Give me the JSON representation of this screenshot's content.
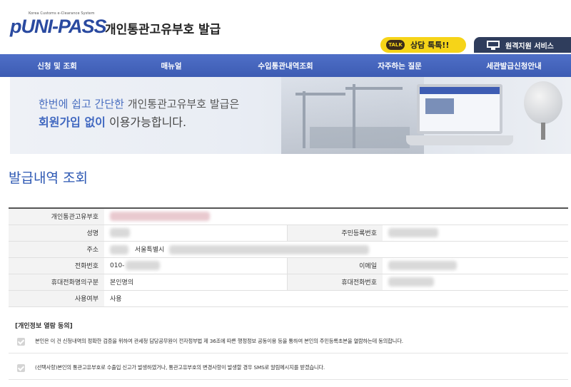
{
  "header": {
    "logo_subtitle": "Korea Customs e-Clearance System",
    "logo_text": "UNI-PASS",
    "logo_prefix": "p",
    "site_title": "개인통관고유부호 발급",
    "talk_icon_text": "TALK",
    "talk_button": "상담 톡톡!!",
    "remote_button": "원격지원 서비스"
  },
  "nav": {
    "items": [
      "신청 및 조회",
      "매뉴얼",
      "수입통관내역조회",
      "자주하는 질문",
      "세관발급신청안내"
    ]
  },
  "banner": {
    "line1_a": "한번에 쉽고 간단한",
    "line1_b": " 개인통관고유부호 발급은",
    "line2_a": "회원가입 없이",
    "line2_b": " 이용가능합니다."
  },
  "page_title": "발급내역 조회",
  "info": {
    "code_label": "개인통관고유부호",
    "name_label": "성명",
    "rrn_label": "주민등록번호",
    "address_label": "주소",
    "address_value": "서울특별시",
    "phone_label": "전화번호",
    "phone_value": "010-",
    "email_label": "이메일",
    "mobile_owner_label": "휴대전화명의구분",
    "mobile_owner_value": "본인명의",
    "mobile_label": "휴대전화번호",
    "usage_label": "사용여부",
    "usage_value": "사용"
  },
  "consent": {
    "title": "[개인정보 열람 동의]",
    "item1": "본인은 이 건 신청내역의 정확한 검증을 위하여 관세청 담당공무원이 전자정부법 제 36조에 따른 행정정보 공동이용 등을 통하여 본인의 주민등록초본을 열람하는데 동의합니다.",
    "item2": "(선택사항)본인의 통관고유부호로 수출입 신고가 발생하였거나, 통관고유부호의 변경사항이 발생할 경우 SMS로 알림메시지를 받겠습니다."
  },
  "colors": {
    "brand_blue": "#3d5cb3",
    "talk_yellow": "#f6d418",
    "remote_navy": "#2f3d5c",
    "title_blue": "#2d58b3"
  },
  "icons": [
    "talk-icon",
    "monitor-icon",
    "checkbox-checked-icon"
  ]
}
